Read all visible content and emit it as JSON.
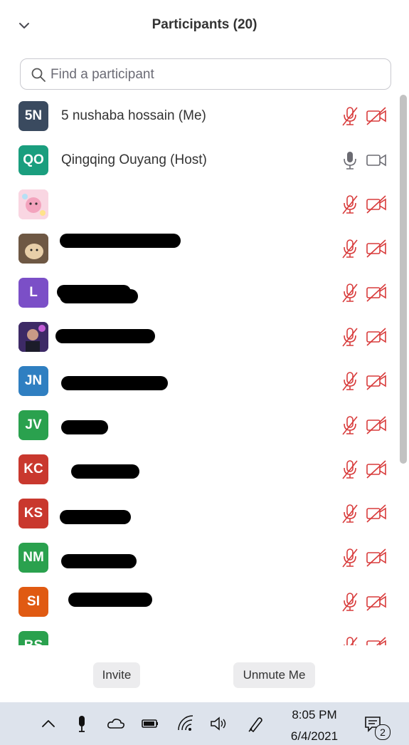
{
  "panel": {
    "title": "Participants (20)",
    "search_placeholder": "Find a participant"
  },
  "participants": [
    {
      "initials": "5N",
      "name": "5 nushaba hossain (Me)",
      "color": "#3a4a5f",
      "mic": "muted",
      "video": "off"
    },
    {
      "initials": "QO",
      "name": "Qingqing Ouyang (Host)",
      "color": "#1a9e7e",
      "mic": "on",
      "video": "on"
    },
    {
      "initials": "",
      "name": "",
      "avatar": "photo",
      "color": "#f6c9d6",
      "mic": "muted",
      "video": "off"
    },
    {
      "initials": "",
      "name": "",
      "avatar": "photo",
      "color": "#b89372",
      "mic": "muted",
      "video": "off"
    },
    {
      "initials": "L",
      "name": "",
      "color": "#7b4fc7",
      "mic": "muted",
      "video": "off"
    },
    {
      "initials": "",
      "name": "",
      "avatar": "photo",
      "color": "#5a3f8c",
      "mic": "muted",
      "video": "off"
    },
    {
      "initials": "JN",
      "name": "",
      "color": "#2f7fc1",
      "mic": "muted",
      "video": "off"
    },
    {
      "initials": "JV",
      "name": "",
      "color": "#2aa14e",
      "mic": "muted",
      "video": "off"
    },
    {
      "initials": "KC",
      "name": "",
      "color": "#c9382e",
      "mic": "muted",
      "video": "off"
    },
    {
      "initials": "KS",
      "name": "",
      "color": "#c9382e",
      "mic": "muted",
      "video": "off"
    },
    {
      "initials": "NM",
      "name": "",
      "color": "#2aa14e",
      "mic": "muted",
      "video": "off"
    },
    {
      "initials": "SI",
      "name": "",
      "color": "#e05a12",
      "mic": "muted",
      "video": "off"
    },
    {
      "initials": "BS",
      "name": "",
      "color": "#2aa14e",
      "mic": "muted",
      "video": "off"
    }
  ],
  "buttons": {
    "invite": "Invite",
    "unmute": "Unmute Me"
  },
  "taskbar": {
    "time": "8:05 PM",
    "date": "6/4/2021",
    "notifications": "2"
  },
  "colors": {
    "muted_red": "#d83b3b",
    "icon_gray": "#6b6b72",
    "taskbar": "#dde3ec"
  }
}
